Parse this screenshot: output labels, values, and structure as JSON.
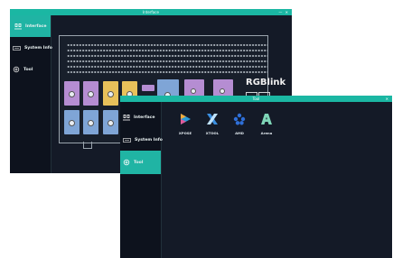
{
  "windows": {
    "back": {
      "title": "Interface",
      "controls": "— ✕",
      "nav": [
        {
          "label": "Interface",
          "icon": "interface-icon"
        },
        {
          "label": "System Info",
          "icon": "keyboard-icon"
        },
        {
          "label": "Tool",
          "icon": "tool-gear-icon"
        }
      ],
      "active_nav": 0,
      "brand": "RGBlink"
    },
    "front": {
      "title": "Tool",
      "controls": "✕",
      "nav": [
        {
          "label": "Interface",
          "icon": "interface-icon"
        },
        {
          "label": "System Info",
          "icon": "keyboard-icon"
        },
        {
          "label": "Tool",
          "icon": "tool-gear-icon"
        }
      ],
      "active_nav": 2,
      "tools": [
        {
          "label": "XPOSE",
          "icon": "xpose-icon"
        },
        {
          "label": "XTOOL",
          "icon": "xtool-icon"
        },
        {
          "label": "AMD",
          "icon": "amd-icon"
        },
        {
          "label": "Arena",
          "icon": "arena-icon"
        }
      ]
    }
  },
  "colors": {
    "accent": "#1bb7a3",
    "window_bg": "#141a27",
    "sidebar_bg": "#0d121d"
  }
}
